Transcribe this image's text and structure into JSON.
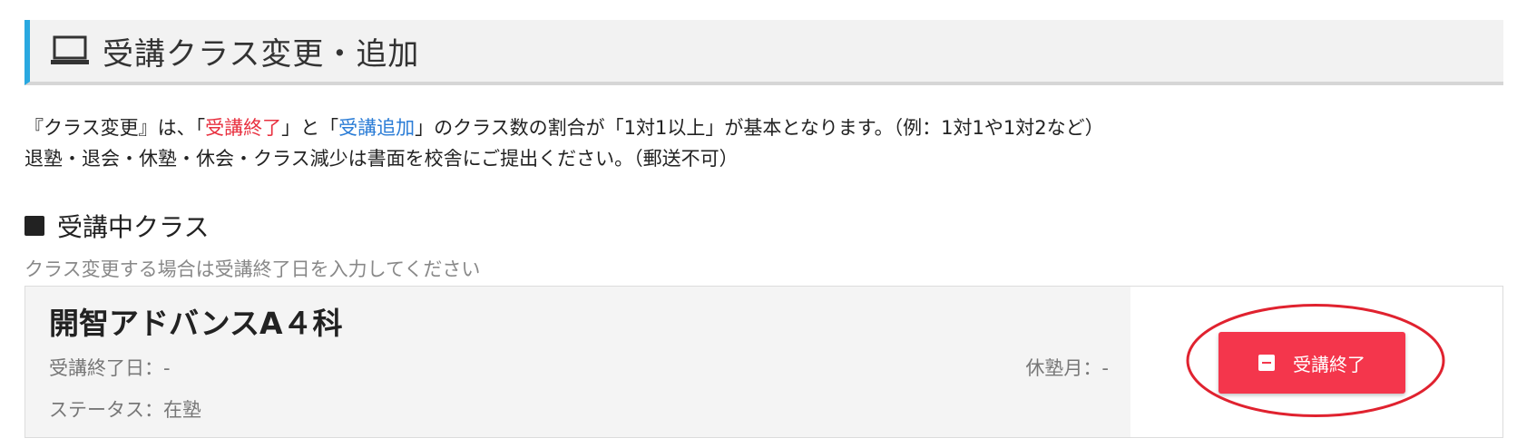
{
  "header": {
    "title": "受講クラス変更・追加",
    "icon": "laptop-icon",
    "accent_color": "#29a8e0"
  },
  "notice": {
    "line1": {
      "part1": "『クラス変更』は、「",
      "end_link": "受講終了",
      "part2": "」と「",
      "add_link": "受講追加",
      "part3": "」のクラス数の割合が「1対1以上」が基本となります。（例：1対1や1対2など）"
    },
    "line2": "退塾・退会・休塾・休会・クラス減少は書面を校舎にご提出ください。（郵送不可）"
  },
  "current_classes": {
    "heading": "受講中クラス",
    "hint": "クラス変更する場合は受講終了日を入力してください",
    "items": [
      {
        "name": "開智アドバンスA４科",
        "end_date": "受講終了日：-",
        "status": "ステータス：在塾",
        "leave_month": "休塾月：-",
        "end_button_label": "受講終了"
      }
    ]
  },
  "colors": {
    "end_button": "#f4364c",
    "annotation": "#e0222f",
    "red_text": "#e8303f",
    "blue_text": "#2a7cd6"
  }
}
